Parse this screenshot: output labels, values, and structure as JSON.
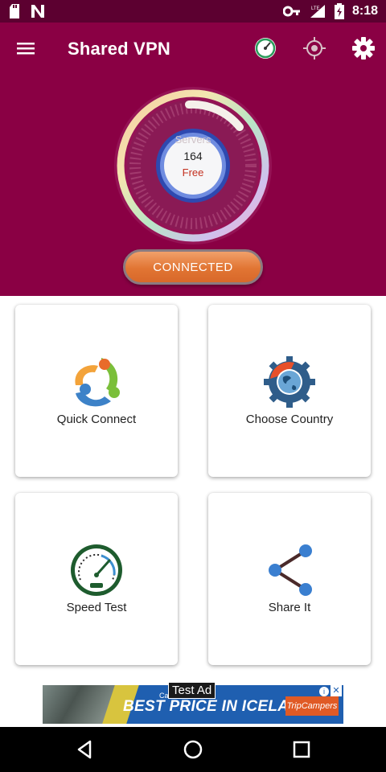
{
  "status_bar": {
    "time": "8:18",
    "network": "LTE",
    "icons": [
      "sd-card-icon",
      "n-notification-icon",
      "vpn-key-icon",
      "signal-icon",
      "battery-icon"
    ]
  },
  "app_bar": {
    "title": "Shared VPN",
    "actions": [
      "speedometer-icon",
      "location-target-icon",
      "settings-gear-icon"
    ]
  },
  "dial": {
    "servers_label": "Servers",
    "servers_count": "164",
    "servers_type": "Free"
  },
  "connect_button": {
    "label": "CONNECTED"
  },
  "cards": [
    {
      "label": "Quick Connect",
      "icon": "quick-connect-icon"
    },
    {
      "label": "Choose Country",
      "icon": "globe-gear-icon"
    },
    {
      "label": "Speed Test",
      "icon": "speedometer-icon"
    },
    {
      "label": "Share It",
      "icon": "share-icon"
    }
  ],
  "ad": {
    "badge": "Test Ad",
    "small_text": "Can",
    "headline": "BEST PRICE IN ICELAND",
    "brand": "TripCampers"
  },
  "nav_bar": [
    "back-icon",
    "home-icon",
    "recents-icon"
  ],
  "colors": {
    "primary": "#8a0044",
    "status_bar": "#5c0030",
    "connected_button": "#e17533",
    "free_text": "#c4301f"
  }
}
